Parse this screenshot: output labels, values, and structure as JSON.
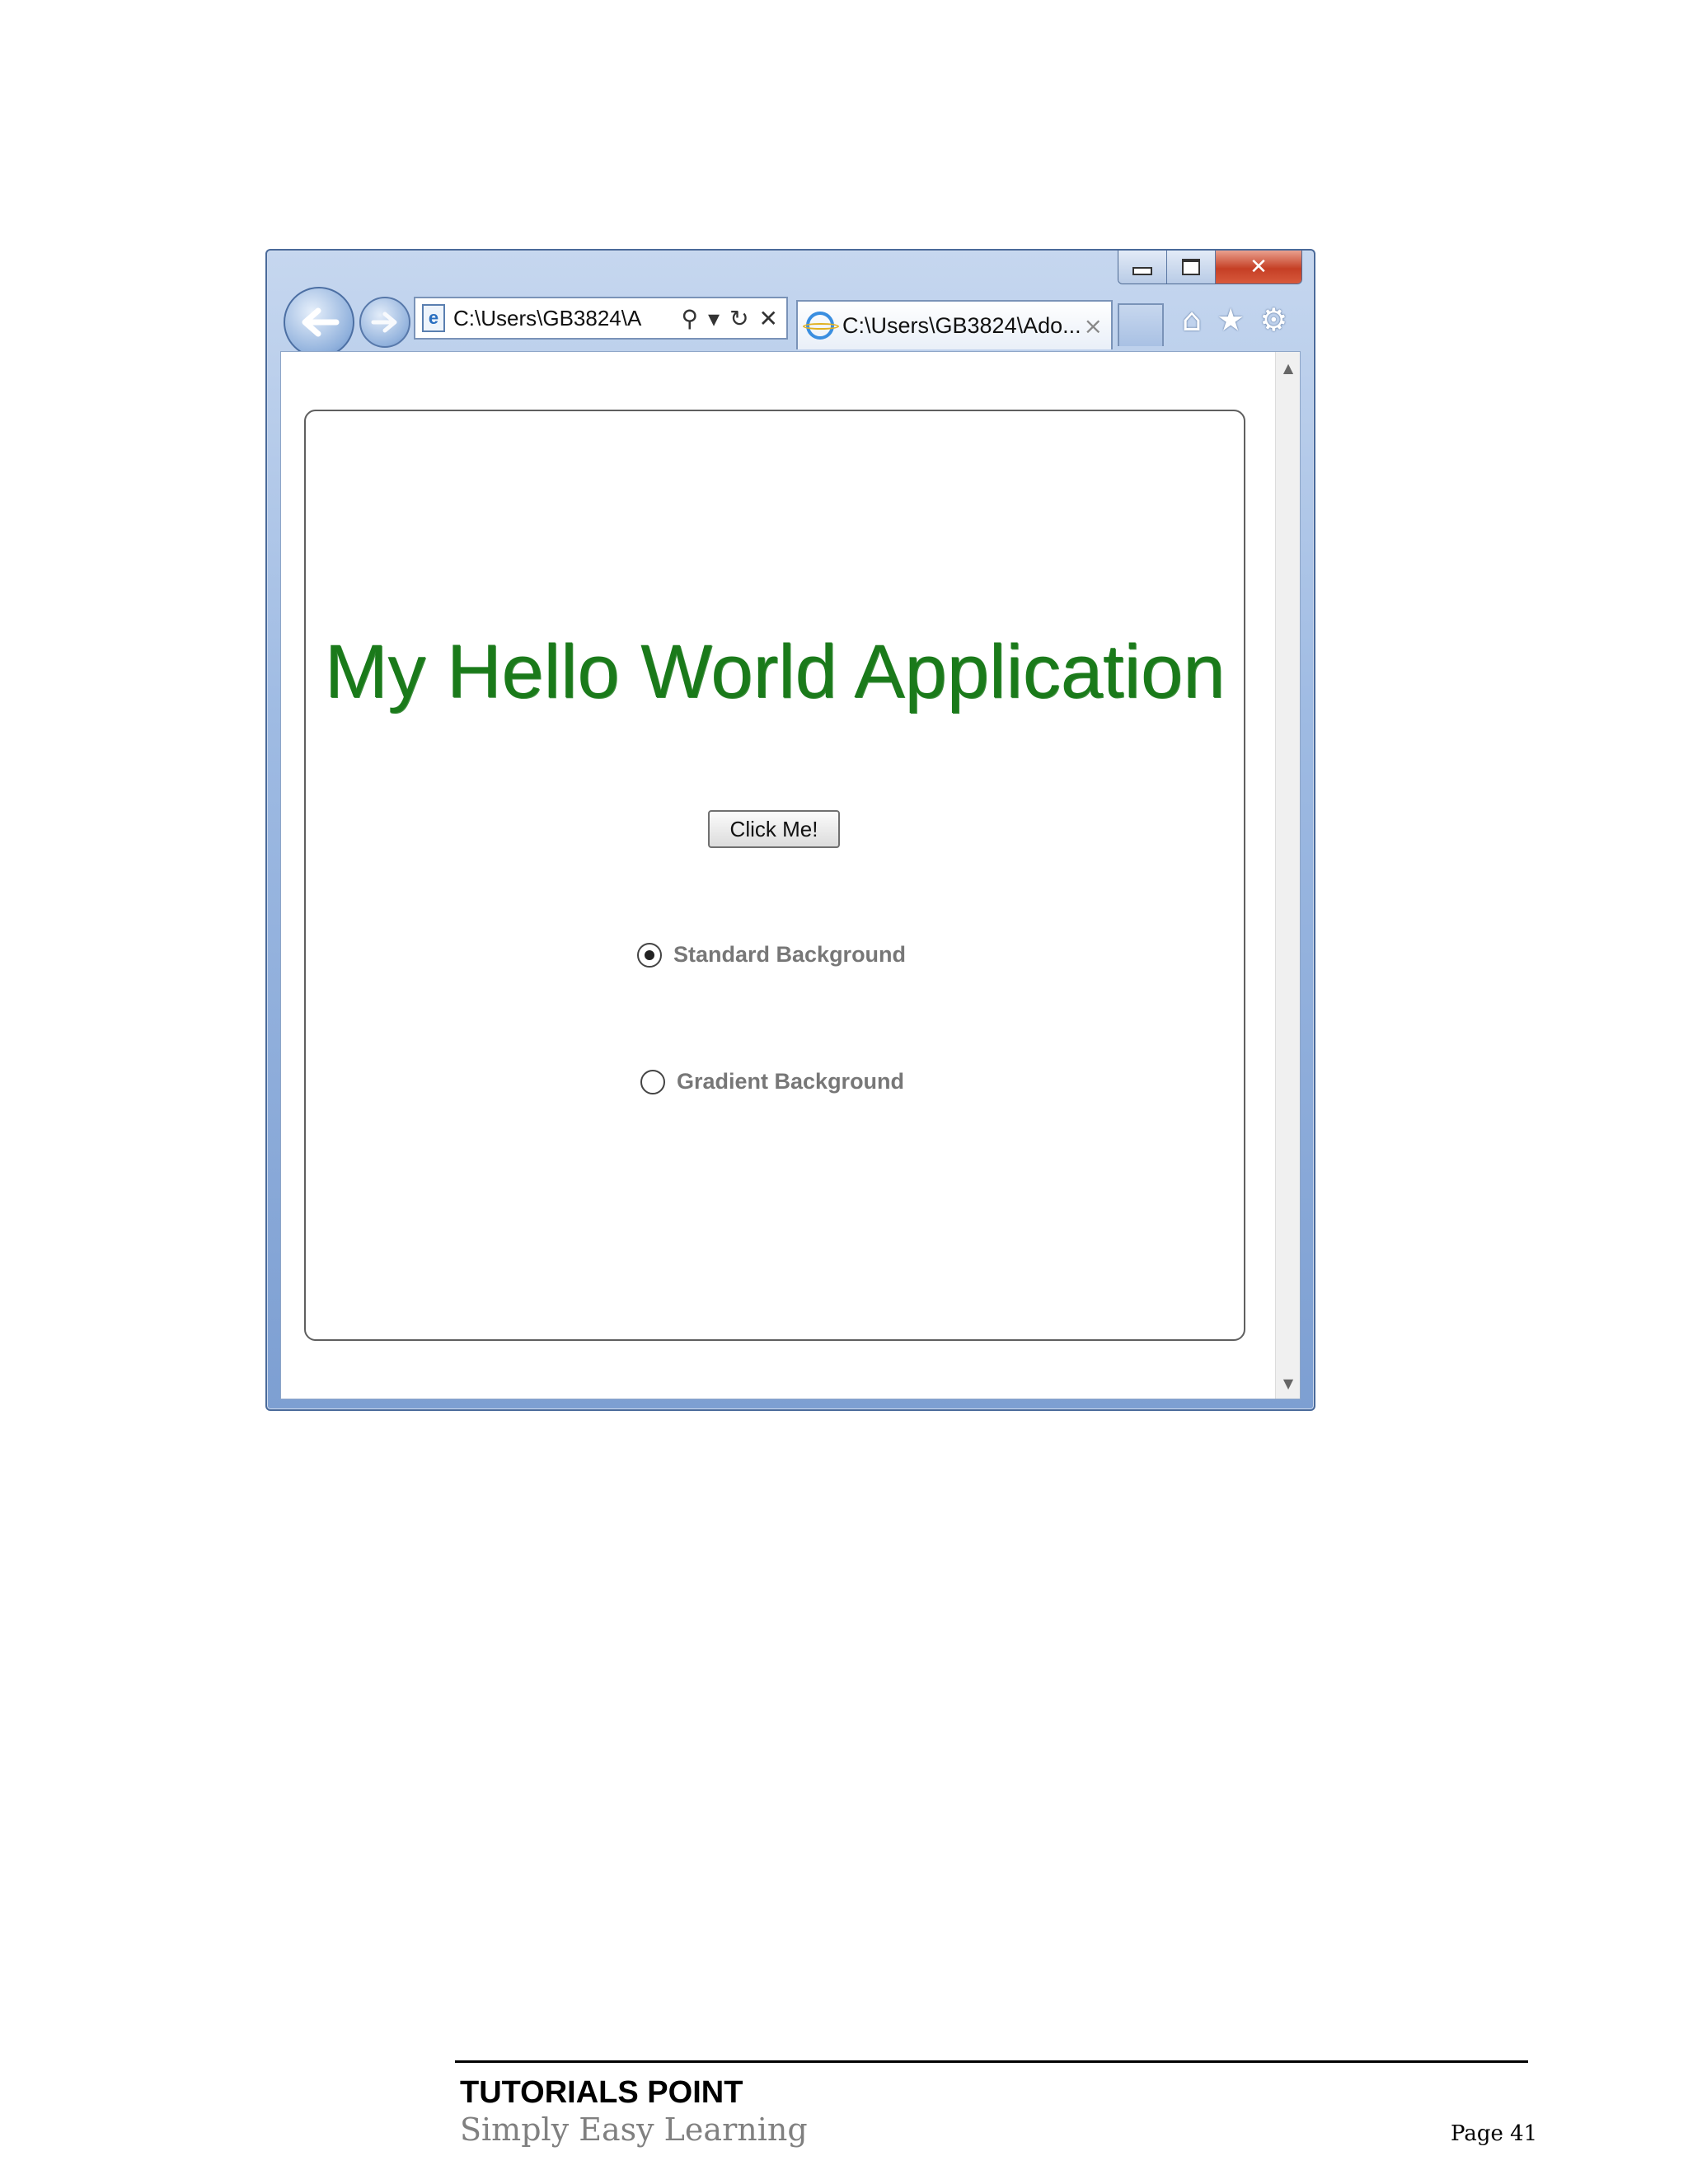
{
  "browser": {
    "address_bar_text": "C:\\Users\\GB3824\\A",
    "tab_title": "C:\\Users\\GB3824\\Ado...",
    "close_glyph": "×",
    "icons": [
      "back-arrow-icon",
      "forward-arrow-icon",
      "search-icon",
      "dropdown-icon",
      "refresh-icon",
      "stop-icon",
      "home-icon",
      "star-icon",
      "gear-icon",
      "minimize-icon",
      "maximize-icon",
      "close-icon"
    ],
    "colors": {
      "frame": "#9fbbe3",
      "close_button": "#c53f25"
    }
  },
  "app": {
    "title": "My Hello World Application",
    "title_color": "#1a7a1a",
    "button_label": "Click Me!",
    "radio_options": [
      {
        "label": "Standard Background",
        "selected": true
      },
      {
        "label": "Gradient Background",
        "selected": false
      }
    ]
  },
  "footer": {
    "brand": "TUTORIALS POINT",
    "tagline": "Simply Easy Learning",
    "page_label": "Page 41"
  }
}
